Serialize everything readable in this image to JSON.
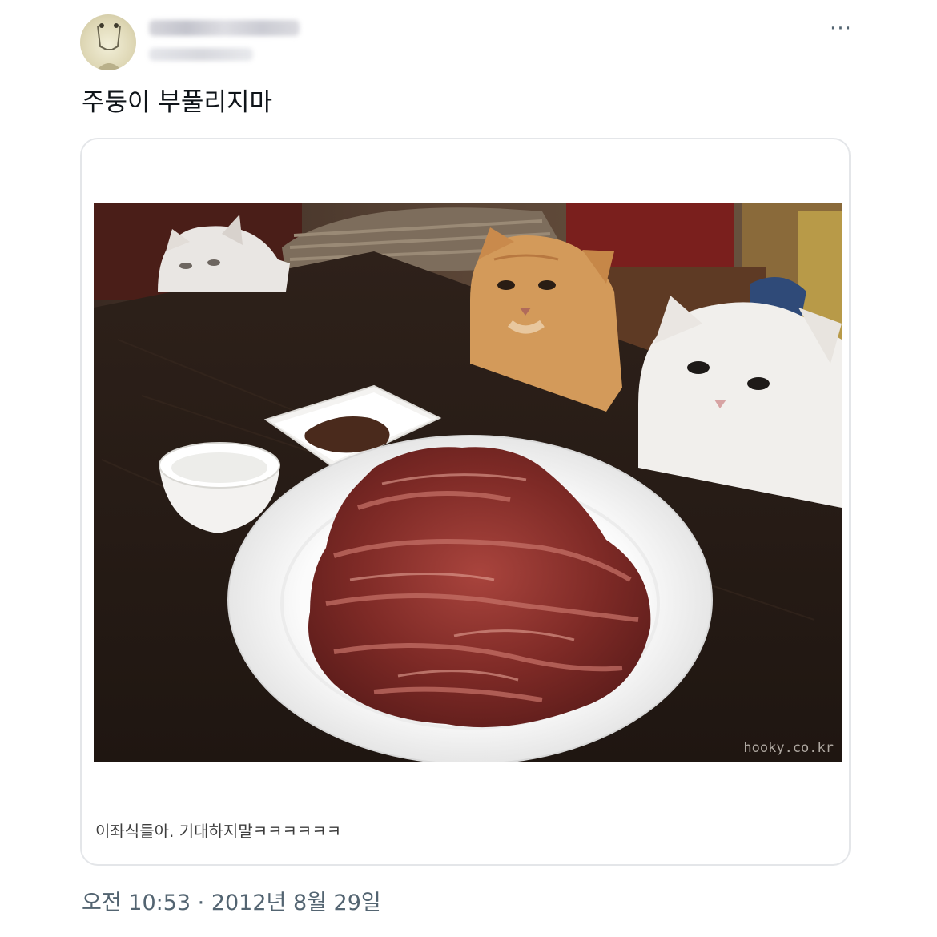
{
  "tweet": {
    "more_icon": "ellipsis-icon",
    "more_label": "···",
    "text": "주둥이 부풀리지마",
    "card": {
      "image_alt": "Cats watching a plate of raw beef",
      "watermark": "hooky.co.kr",
      "caption": "이좌식들아. 기대하지말ㅋㅋㅋㅋㅋㅋ"
    },
    "timestamp": "오전 10:53 · 2012년 8월 29일"
  },
  "colors": {
    "text": "#0f1419",
    "secondary": "#536471",
    "border": "#e4e6e9"
  }
}
